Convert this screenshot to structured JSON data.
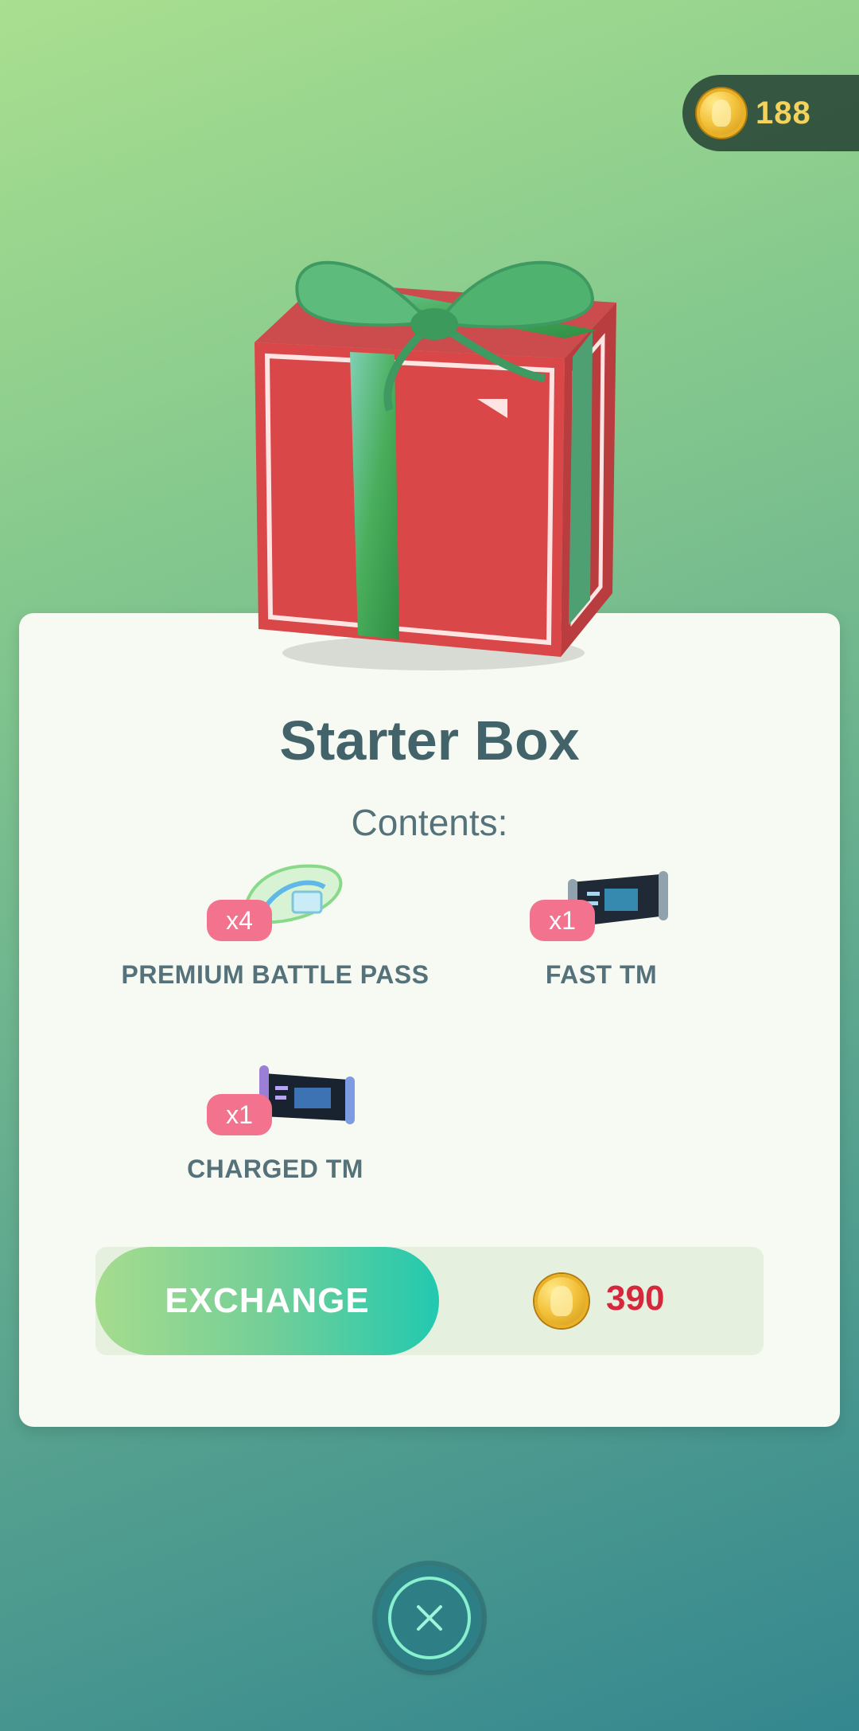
{
  "wallet": {
    "balance": "188",
    "icon": "coin-icon"
  },
  "offer": {
    "title": "Starter Box",
    "contents_heading": "Contents:",
    "items": [
      {
        "quantity": "x4",
        "label": "PREMIUM BATTLE PASS",
        "icon": "premium-battle-pass-icon"
      },
      {
        "quantity": "x1",
        "label": "FAST TM",
        "icon": "fast-tm-icon"
      },
      {
        "quantity": "x1",
        "label": "CHARGED TM",
        "icon": "charged-tm-icon"
      }
    ],
    "exchange_label": "EXCHANGE",
    "price": "390"
  },
  "colors": {
    "qty_badge": "#f3728e",
    "price_text": "#d6283d",
    "coin_text": "#f4d25c",
    "title_text": "#43636a"
  },
  "close_icon": "close-icon"
}
